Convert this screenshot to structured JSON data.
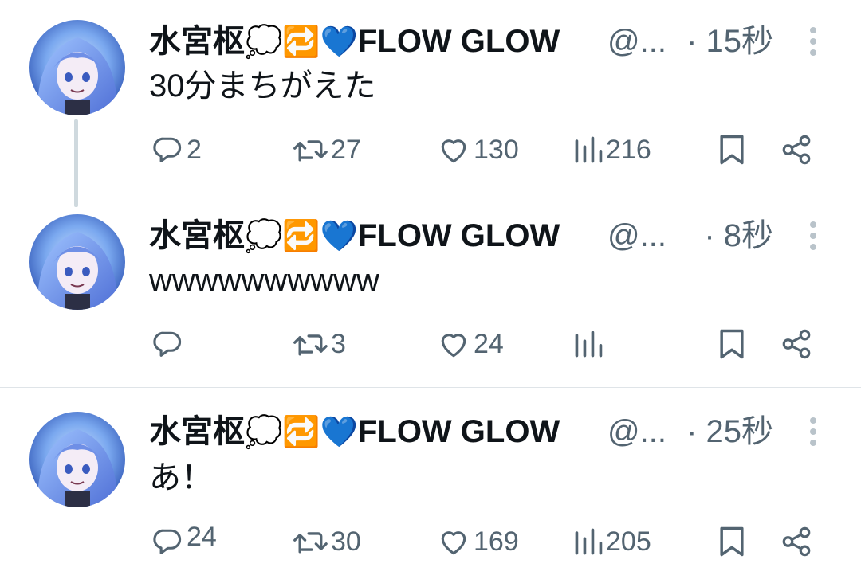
{
  "tweets": [
    {
      "author_name": "水宮枢",
      "name_emojis": "💭🔁💙",
      "name_suffix": "FLOW GLOW",
      "handle": "@...",
      "time": "· 15秒",
      "text": "30分まちがえた",
      "replies": "2",
      "retweets": "27",
      "likes": "130",
      "views": "216"
    },
    {
      "author_name": "水宮枢",
      "name_emojis": "💭🔁💙",
      "name_suffix": "FLOW GLOW",
      "handle": "@...",
      "time": "· 8秒",
      "text": "wwwwwwwwww",
      "replies": "",
      "retweets": "3",
      "likes": "24",
      "views": ""
    },
    {
      "author_name": "水宮枢",
      "name_emojis": "💭🔁💙",
      "name_suffix": "FLOW GLOW",
      "handle": "@...",
      "time": "· 25秒",
      "text": "あ！",
      "replies": "24",
      "retweets": "30",
      "likes": "169",
      "views": "205"
    }
  ],
  "icons": {
    "reply": "reply-icon",
    "retweet": "retweet-icon",
    "like": "like-icon",
    "views": "views-icon",
    "bookmark": "bookmark-icon",
    "share": "share-icon",
    "more": "more-vertical-icon"
  },
  "colors": {
    "text": "#0f1419",
    "secondary": "#536471",
    "thread_line": "#cfd9de",
    "divider": "#dfe4e8"
  }
}
